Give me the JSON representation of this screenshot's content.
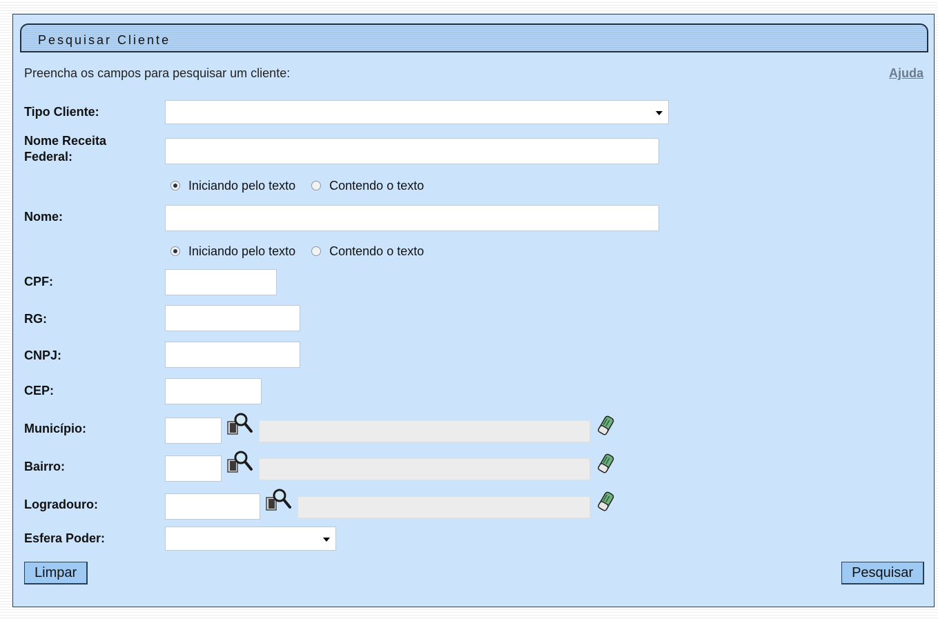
{
  "panel": {
    "title": "Pesquisar Cliente",
    "intro": "Preencha os campos para pesquisar um cliente:",
    "help": "Ajuda"
  },
  "fields": {
    "tipo_cliente": {
      "label": "Tipo Cliente:",
      "value": ""
    },
    "nome_receita": {
      "label_line1": "Nome Receita",
      "label_line2": "Federal:",
      "value": ""
    },
    "nome": {
      "label": "Nome:",
      "value": ""
    },
    "cpf": {
      "label": "CPF:",
      "value": ""
    },
    "rg": {
      "label": "RG:",
      "value": ""
    },
    "cnpj": {
      "label": "CNPJ:",
      "value": ""
    },
    "cep": {
      "label": "CEP:",
      "value": ""
    },
    "municipio": {
      "label": "Município:",
      "code": "",
      "description": ""
    },
    "bairro": {
      "label": "Bairro:",
      "code": "",
      "description": ""
    },
    "logradouro": {
      "label": "Logradouro:",
      "code": "",
      "description": ""
    },
    "esfera_poder": {
      "label": "Esfera Poder:",
      "value": ""
    }
  },
  "radios": {
    "start_label": "Iniciando pelo texto",
    "contain_label": "Contendo o texto",
    "nome_receita_selected": "start",
    "nome_selected": "start"
  },
  "buttons": {
    "clear": "Limpar",
    "search": "Pesquisar"
  },
  "icons": {
    "lookup": "magnifier-lookup-icon",
    "clear": "eraser-icon"
  }
}
